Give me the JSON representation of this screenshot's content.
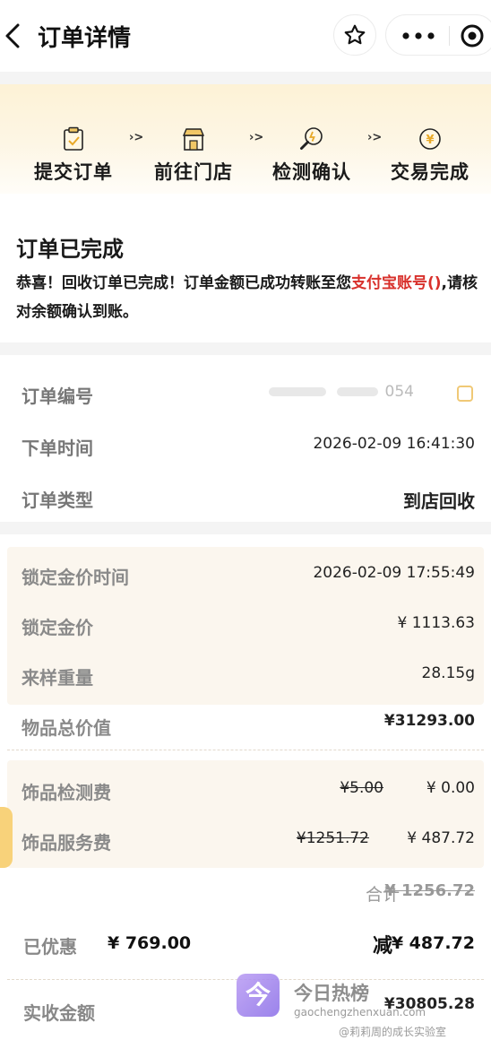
{
  "header": {
    "title": "订单详情"
  },
  "progress": {
    "steps": [
      {
        "label": "提交订单",
        "icon": "clipboard-check-icon"
      },
      {
        "label": "前往门店",
        "icon": "store-icon"
      },
      {
        "label": "检测确认",
        "icon": "magnifier-icon"
      },
      {
        "label": "交易完成",
        "icon": "yuan-coin-icon"
      }
    ],
    "arrow": "›>"
  },
  "status": {
    "title": "订单已完成",
    "message_before": "恭喜！回收订单已完成！订单金额已成功转账至您",
    "message_highlight": "支付宝账号()",
    "message_after": ",请核对余额确认到账。"
  },
  "order_info": {
    "number_label": "订单编号",
    "number_value_visible": "054",
    "time_label": "下单时间",
    "time_value": "2026-02-09 16:41:30",
    "type_label": "订单类型",
    "type_value": "到店回收"
  },
  "price": {
    "lock_time_label": "锁定金价时间",
    "lock_time_value": "2026-02-09 17:55:49",
    "lock_price_label": "锁定金价",
    "lock_price_value": "¥ 1113.63",
    "weight_label": "来样重量",
    "weight_value": "28.15g",
    "total_label": "物品总价值",
    "total_value": "¥31293.00",
    "check_fee_label": "饰品检测费",
    "check_fee_original": "¥5.00",
    "check_fee_value": "¥ 0.00",
    "service_fee_label": "饰品服务费",
    "service_fee_original": "¥1251.72",
    "service_fee_value": "¥ 487.72",
    "subtotal_label": "合计",
    "subtotal_value": "¥ 1256.72",
    "discount_label": "已优惠",
    "discount_value": "¥ 769.00",
    "deduct_label": "减",
    "deduct_value": "¥ 487.72",
    "received_label": "实收金额",
    "received_value": "¥30805.28"
  },
  "watermark": {
    "logo_text": "今",
    "name": "今日热榜",
    "url": "gaochengzhenxuan.com",
    "credit": "@莉莉周的成长实验室"
  },
  "colors": {
    "accent_red": "#e0462f",
    "highlight_red": "#d8302b",
    "banner": "#fdf2d6"
  }
}
